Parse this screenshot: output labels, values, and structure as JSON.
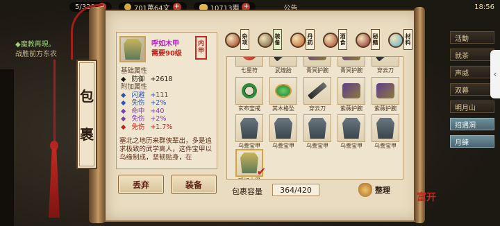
{
  "hud": {
    "energy": "5/320",
    "silver": "701萬64文",
    "ingots": "10713兩",
    "announcement": "公告",
    "clock": "18:56"
  },
  "quest": {
    "title": "◆魔教再現。",
    "body": "战胜前方东农"
  },
  "right_menu": [
    "活動",
    "就茶",
    "声威",
    "双幕",
    "明月山",
    "招遇洞",
    "月練"
  ],
  "panel": {
    "title_chars": [
      "包",
      "裹"
    ],
    "item": {
      "name": "呼如木甲",
      "requirement": "需要90级",
      "seal_top": "内",
      "seal_bottom": "甲"
    },
    "stats": {
      "base_header": "基础属性",
      "base": [
        {
          "name": "防御",
          "value": "+2618",
          "color": "#241a10"
        }
      ],
      "bonus_header": "附加属性",
      "bonus": [
        {
          "name": "闪避",
          "value": "+111",
          "color": "#2a55b8"
        },
        {
          "name": "免伤",
          "value": "+2%",
          "color": "#2a55b8"
        },
        {
          "name": "命中",
          "value": "+40",
          "color": "#7a3fb0"
        },
        {
          "name": "免伤",
          "value": "+2%",
          "color": "#7a3fb0"
        },
        {
          "name": "免伤",
          "value": "+1.7%",
          "color": "#c3221c"
        }
      ]
    },
    "description": "塞北之地历来群侠辈出，多是追求极致的武学高人，这件宝甲以乌缘制成，坚韧贴身，在",
    "discard_label": "丢弃",
    "equip_label": "装备",
    "tabs": [
      {
        "label": "杂项",
        "orb": "#9a3b1e"
      },
      {
        "label": "装备",
        "orb": "#6a5a3c"
      },
      {
        "label": "丹药",
        "orb": "#c05a20"
      },
      {
        "label": "酒食",
        "orb": "#a6452a"
      },
      {
        "label": "秘籍",
        "orb": "#8b2b2b"
      },
      {
        "label": "材料",
        "orb": "#5ab0d6"
      }
    ],
    "active_tab": 1,
    "grid_rows": [
      [
        {
          "name": "七星符",
          "icon": "ic-pearl"
        },
        {
          "name": "武煌胎",
          "icon": "ic-blade"
        },
        {
          "name": "青冥护腕",
          "icon": "ic-bracer"
        },
        {
          "name": "青冥护腕",
          "icon": "ic-bracer"
        },
        {
          "name": "穿云刀",
          "icon": "ic-blade"
        }
      ],
      [
        {
          "name": "玄布宝戒",
          "icon": "ic-ring"
        },
        {
          "name": "其木格坠",
          "icon": "ic-jade"
        },
        {
          "name": "穿云刀",
          "icon": "ic-blade"
        },
        {
          "name": "紫薇护腕",
          "icon": "ic-bracer"
        },
        {
          "name": "紫薇护腕",
          "icon": "ic-bracer"
        }
      ],
      [
        {
          "name": "乌誊宝甲",
          "icon": "ic-armor"
        },
        {
          "name": "乌誊宝甲",
          "icon": "ic-armor"
        },
        {
          "name": "乌誊宝甲",
          "icon": "ic-armor"
        },
        {
          "name": "乌誊宝甲",
          "icon": "ic-armor"
        },
        {
          "name": "乌誊宝甲",
          "icon": "ic-armor"
        }
      ],
      [
        {
          "name": "呼如木甲",
          "icon": "ic-armor-gold",
          "selected": true
        }
      ]
    ],
    "capacity_label": "包裹容量",
    "capacity_value": "364/420",
    "sort_label": "整理",
    "stamp": "富开"
  }
}
